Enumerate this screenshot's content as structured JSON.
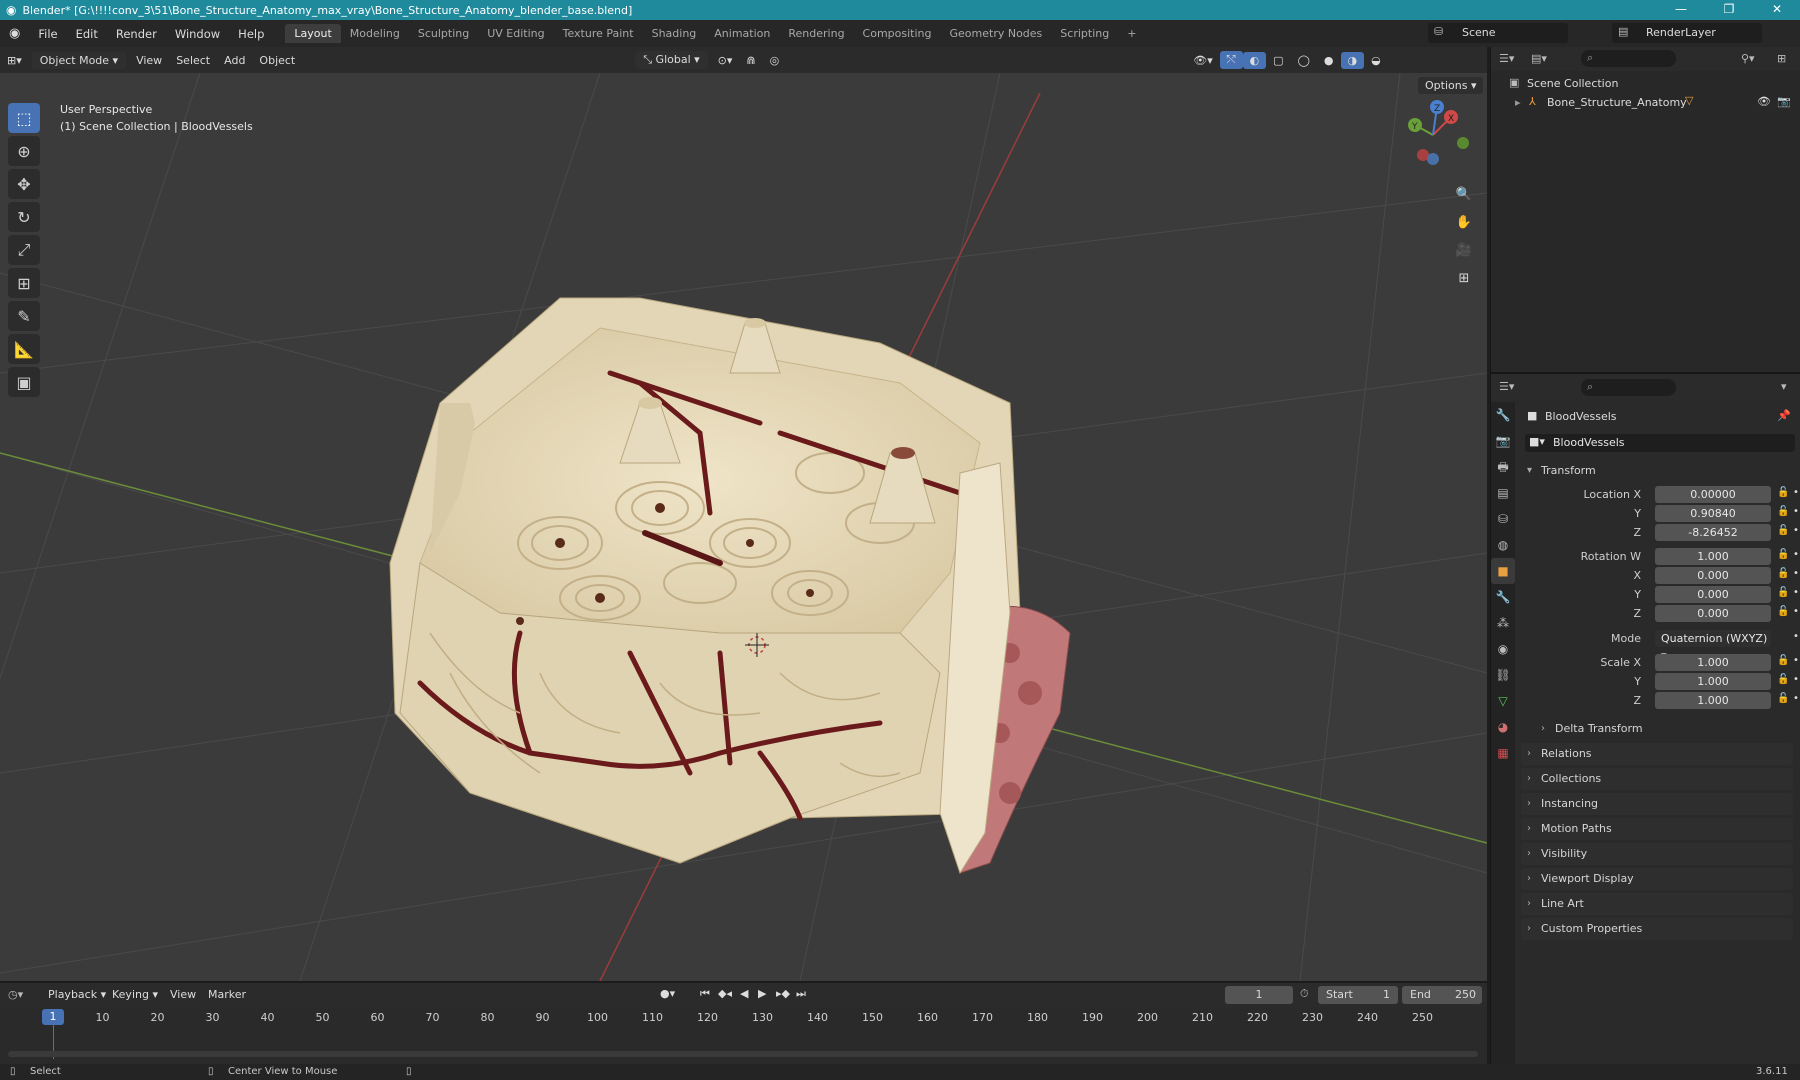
{
  "window": {
    "title": "Blender* [G:\\!!!!conv_3\\51\\Bone_Structure_Anatomy_max_vray\\Bone_Structure_Anatomy_blender_base.blend]"
  },
  "menu": {
    "items": [
      "File",
      "Edit",
      "Render",
      "Window",
      "Help"
    ]
  },
  "workspaces": {
    "tabs": [
      "Layout",
      "Modeling",
      "Sculpting",
      "UV Editing",
      "Texture Paint",
      "Shading",
      "Animation",
      "Rendering",
      "Compositing",
      "Geometry Nodes",
      "Scripting"
    ],
    "active": "Layout",
    "add": "+"
  },
  "topright": {
    "scene_label": "Scene",
    "renderlayer_label": "RenderLayer"
  },
  "viewport_header": {
    "mode": "Object Mode",
    "menus": [
      "View",
      "Select",
      "Add",
      "Object"
    ],
    "orientation": "Global",
    "options": "Options"
  },
  "viewport": {
    "line1": "User Perspective",
    "line2": "(1) Scene Collection | BloodVessels"
  },
  "gizmo": {
    "x": "X",
    "y": "Y",
    "z": "Z"
  },
  "outliner": {
    "root": "Scene Collection",
    "item": "Bone_Structure_Anatomy"
  },
  "properties": {
    "object_name": "BloodVessels",
    "datablock": "BloodVessels",
    "transform_label": "Transform",
    "location": {
      "label": "Location X",
      "x": "0.00000",
      "y_label": "Y",
      "y": "0.90840",
      "z_label": "Z",
      "z": "-8.26452"
    },
    "rotation": {
      "label": "Rotation W",
      "w": "1.000",
      "x_label": "X",
      "x": "0.000",
      "y_label": "Y",
      "y": "0.000",
      "z_label": "Z",
      "z": "0.000"
    },
    "mode": {
      "label": "Mode",
      "value": "Quaternion (WXYZ)"
    },
    "scale": {
      "label": "Scale X",
      "x": "1.000",
      "y_label": "Y",
      "y": "1.000",
      "z_label": "Z",
      "z": "1.000"
    },
    "delta": "Delta Transform",
    "panels": [
      "Relations",
      "Collections",
      "Instancing",
      "Motion Paths",
      "Visibility",
      "Viewport Display",
      "Line Art",
      "Custom Properties"
    ]
  },
  "timeline": {
    "menus": [
      "Playback",
      "Keying",
      "View",
      "Marker"
    ],
    "current_frame": "1",
    "start_label": "Start",
    "start": "1",
    "end_label": "End",
    "end": "250",
    "frame_marks": [
      "10",
      "20",
      "30",
      "40",
      "50",
      "60",
      "70",
      "80",
      "90",
      "100",
      "110",
      "120",
      "130",
      "140",
      "150",
      "160",
      "170",
      "180",
      "190",
      "200",
      "210",
      "220",
      "230",
      "240",
      "250"
    ],
    "cursor": "1"
  },
  "status": {
    "select": "Select",
    "center": "Center View to Mouse",
    "version": "3.6.11"
  },
  "colors": {
    "accent": "#4772b3",
    "titlebar": "#1f8a9c",
    "bone": "#e8dcc0",
    "vessel": "#6a1a1a",
    "marrow": "#c07878"
  }
}
